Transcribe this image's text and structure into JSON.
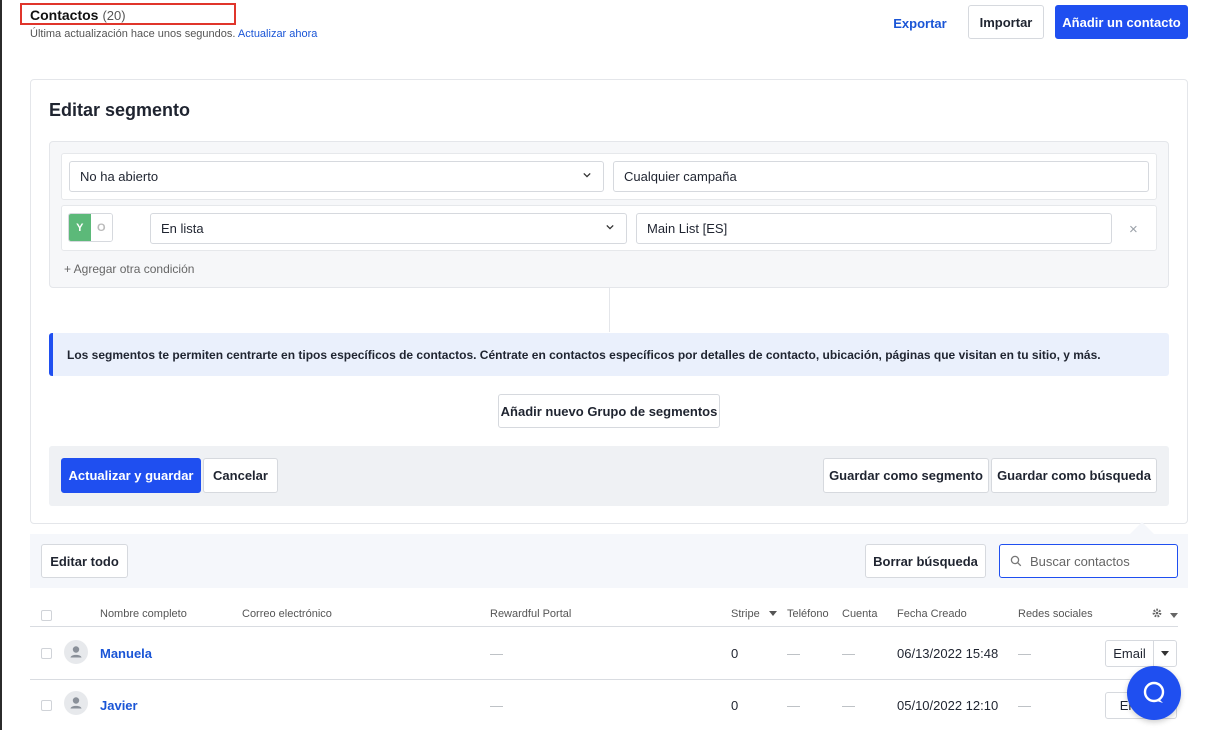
{
  "header": {
    "title": "Contactos",
    "count": "(20)",
    "subtitle": "Última actualización hace unos segundos.",
    "refresh_link": "Actualizar ahora",
    "export_label": "Exportar",
    "import_label": "Importar",
    "add_contact_label": "Añadir un contacto"
  },
  "segment": {
    "title": "Editar segmento",
    "condition1": {
      "field": "No ha abierto",
      "value": "Cualquier campaña"
    },
    "condition2": {
      "toggle_y": "Y",
      "toggle_o": "O",
      "field": "En lista",
      "value": "Main List [ES]",
      "remove": "×"
    },
    "add_condition": "+ Agregar otra condición",
    "info_text": "Los segmentos te permiten centrarte en tipos específicos de contactos. Céntrate en contactos específicos por detalles de contacto, ubicación, páginas que visitan en tu sitio, y más.",
    "add_group_label": "Añadir nuevo Grupo de segmentos",
    "update_save_label": "Actualizar y guardar",
    "cancel_label": "Cancelar",
    "save_segment_label": "Guardar como segmento",
    "save_search_label": "Guardar como búsqueda"
  },
  "table": {
    "edit_all_label": "Editar todo",
    "clear_search_label": "Borrar búsqueda",
    "search_placeholder": "Buscar contactos",
    "columns": [
      "Nombre completo",
      "Correo electrónico",
      "Rewardful Portal",
      "Stripe",
      "Teléfono",
      "Cuenta",
      "Fecha Creado",
      "Redes sociales"
    ],
    "rows": [
      {
        "name": "Manuela",
        "rewardful": "—",
        "stripe": "0",
        "phone": "—",
        "account": "—",
        "created": "06/13/2022 15:48",
        "social": "—",
        "action": "Email"
      },
      {
        "name": "Javier",
        "rewardful": "—",
        "stripe": "0",
        "phone": "—",
        "account": "—",
        "created": "05/10/2022 12:10",
        "social": "—",
        "action": "Em"
      }
    ]
  },
  "colors": {
    "accent": "#1f4ff0",
    "toggle_active": "#5cb979",
    "highlight_border": "#e0352b"
  }
}
